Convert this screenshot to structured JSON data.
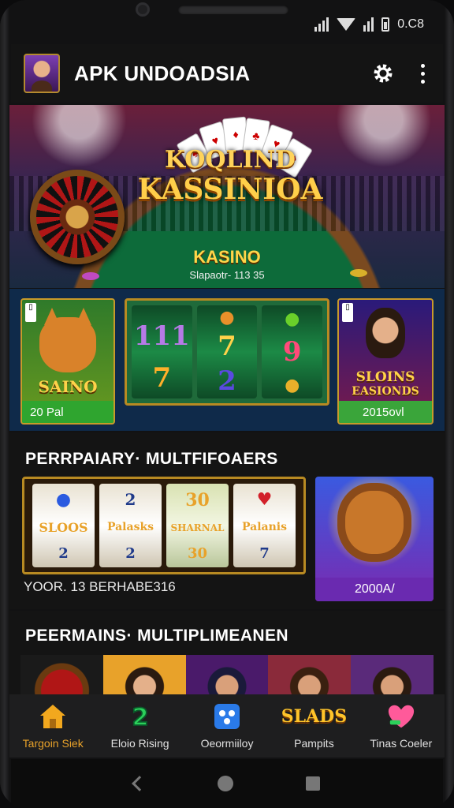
{
  "status": {
    "right_text": "0.C8"
  },
  "app": {
    "title": "APK UNDOADSIA"
  },
  "hero": {
    "logo_line1": "KOQLIND",
    "logo_line2": "KASSINIOA",
    "table_label": "KASINO",
    "table_sub": "Slapaotr- 113 35"
  },
  "featured": {
    "left": {
      "name": "SAINO",
      "label": "20 Pal",
      "bar_color": "#2fa52f"
    },
    "center": {
      "reels": [
        [
          "",
          "111",
          "7"
        ],
        [
          "",
          "7",
          "2"
        ],
        [
          "",
          "9",
          ""
        ]
      ]
    },
    "right": {
      "name_line1": "SLOINS",
      "name_line2": "EASIONDS",
      "label": "2015ovl",
      "bar_color": "#3aa53a"
    }
  },
  "section1": {
    "title": "PERRPAIARY· MULTFIFOAERS",
    "reels": [
      [
        "SLOOS",
        "2"
      ],
      [
        "Palasks",
        "2"
      ],
      [
        "SHARNAL",
        "30"
      ],
      [
        "Palanis",
        "7"
      ]
    ],
    "caption": "YOOR. 13 BERHABE316",
    "lion_label": "2000A/"
  },
  "section2": {
    "title": "PEERMAINS· MULTIPLIMEANEN"
  },
  "nav": {
    "items": [
      {
        "label": "Targoin Siek",
        "icon": "home-icon",
        "active": true
      },
      {
        "label": "Eloio Rising",
        "icon": "two-icon",
        "active": false
      },
      {
        "label": "Oeormiiloy",
        "icon": "dice-icon",
        "active": false
      },
      {
        "label": "Pampits",
        "icon": "slads-icon",
        "icon_text": "SLADS",
        "active": false
      },
      {
        "label": "Tinas Coeler",
        "icon": "heart-icon",
        "active": false
      }
    ]
  },
  "colors": {
    "accent": "#e8a22a",
    "gold": "#ffd24a",
    "nav_bg": "#1e1e1f"
  }
}
